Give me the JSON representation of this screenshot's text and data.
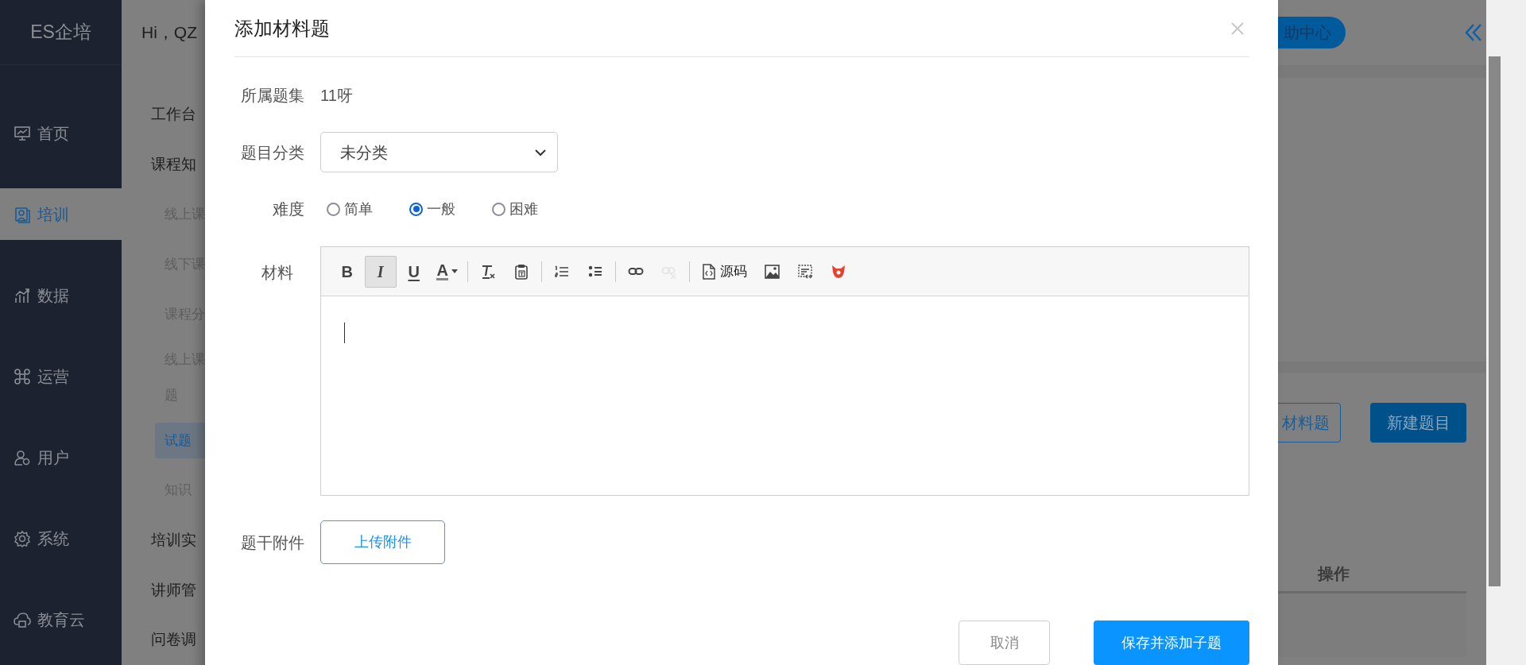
{
  "sidebar": {
    "logo": "ES企培",
    "items": [
      {
        "kind": "home",
        "label": "首页",
        "selected": false
      },
      {
        "kind": "training",
        "label": "培训",
        "selected": true
      },
      {
        "kind": "data",
        "label": "数据",
        "selected": false
      },
      {
        "kind": "operations",
        "label": "运营",
        "selected": false
      },
      {
        "kind": "users",
        "label": "用户",
        "selected": false
      },
      {
        "kind": "system",
        "label": "系统",
        "selected": false
      },
      {
        "kind": "cloud",
        "label": "教育云",
        "selected": false
      }
    ]
  },
  "header": {
    "greeting": "Hi，QZ",
    "help_button": "助中心"
  },
  "submenu": [
    {
      "kind": "group",
      "label": "工作台",
      "selected": false
    },
    {
      "kind": "group",
      "label": "课程知",
      "selected": false
    },
    {
      "kind": "item",
      "label": "线上课",
      "selected": false
    },
    {
      "kind": "item",
      "label": "线下课",
      "selected": false
    },
    {
      "kind": "item",
      "label": "课程分",
      "selected": false
    },
    {
      "kind": "item",
      "label": "线上课题",
      "selected": false
    },
    {
      "kind": "item",
      "label": "试题",
      "selected": true
    },
    {
      "kind": "item",
      "label": "知识",
      "selected": false
    },
    {
      "kind": "group",
      "label": "培训实",
      "selected": false
    },
    {
      "kind": "group",
      "label": "讲师管",
      "selected": false
    },
    {
      "kind": "group",
      "label": "问卷调",
      "selected": false
    }
  ],
  "page_actions": [
    {
      "kind": "outline",
      "label": "材料题"
    },
    {
      "kind": "primary",
      "label": "新建题目"
    }
  ],
  "table": {
    "columns": [
      "操作"
    ]
  },
  "dialog": {
    "title": "添加材料题",
    "question_set": {
      "label": "所属题集",
      "value": "11呀"
    },
    "category": {
      "label": "题目分类",
      "value": "未分类"
    },
    "difficulty": {
      "label": "难度",
      "options": [
        {
          "label": "简单",
          "selected": false
        },
        {
          "label": "一般",
          "selected": true
        },
        {
          "label": "困难",
          "selected": false
        }
      ]
    },
    "material": {
      "label": "材料",
      "toolbar": [
        [
          {
            "kind": "bold",
            "label": "B",
            "active": false,
            "disabled": false
          },
          {
            "kind": "italic",
            "label": "I",
            "active": true,
            "disabled": false
          },
          {
            "kind": "underline",
            "label": "U",
            "active": false,
            "disabled": false
          },
          {
            "kind": "font-color",
            "label": "A",
            "active": false,
            "disabled": false
          }
        ],
        [
          {
            "kind": "clear-format",
            "active": false,
            "disabled": false
          },
          {
            "kind": "paste-text",
            "active": false,
            "disabled": false
          }
        ],
        [
          {
            "kind": "ordered-list",
            "active": false,
            "disabled": false
          },
          {
            "kind": "bullet-list",
            "active": false,
            "disabled": false
          }
        ],
        [
          {
            "kind": "link",
            "active": false,
            "disabled": false
          },
          {
            "kind": "unlink",
            "active": false,
            "disabled": true
          }
        ],
        [
          {
            "kind": "source",
            "label": "源码",
            "active": false,
            "disabled": false
          },
          {
            "kind": "image",
            "active": false,
            "disabled": false
          },
          {
            "kind": "template",
            "active": false,
            "disabled": false
          },
          {
            "kind": "plugin",
            "active": false,
            "disabled": false
          }
        ]
      ]
    },
    "attachment": {
      "label": "题干附件",
      "button": "上传附件"
    },
    "buttons": [
      {
        "kind": "secondary",
        "label": "取消"
      },
      {
        "kind": "primary",
        "label": "保存并添加子题"
      }
    ]
  }
}
